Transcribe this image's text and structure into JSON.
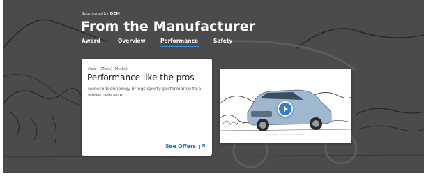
{
  "sponsor": {
    "prefix": "Sponsored by",
    "brand": "OEM"
  },
  "hero": {
    "title": "From the Manufacturer"
  },
  "tabs": [
    {
      "label": "Award",
      "active": false
    },
    {
      "label": "Overview",
      "active": false
    },
    {
      "label": "Performance",
      "active": true
    },
    {
      "label": "Safety",
      "active": false
    }
  ],
  "card": {
    "eyebrow": "(Year) (Make) (Model)",
    "headline": "Performance like the pros",
    "description": "Genero technology brings sporty performance to a whole new level.",
    "cta_label": "See Offers",
    "cta_icon": "external-link-icon"
  },
  "media": {
    "play_icon": "play-icon",
    "caption": "Genero 2019. Clean demo for illustration"
  },
  "colors": {
    "accent": "#3c8de0",
    "link": "#1f6fcf",
    "background": "#4a4a4a",
    "play_button": "#2f7fd8"
  }
}
